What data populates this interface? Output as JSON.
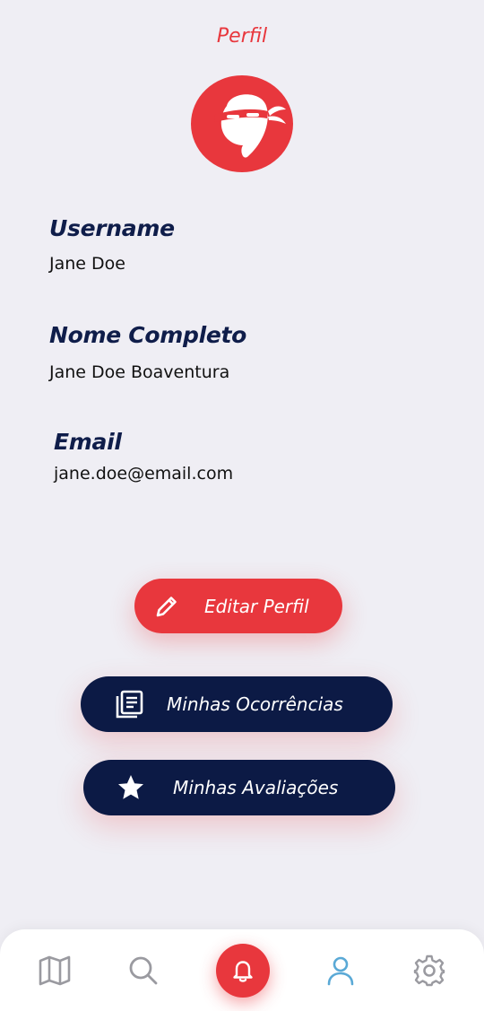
{
  "header": {
    "title": "Perfil"
  },
  "profile": {
    "fields": [
      {
        "label": "Username",
        "value": "Jane Doe"
      },
      {
        "label": "Nome Completo",
        "value": "Jane Doe Boaventura"
      },
      {
        "label": "Email",
        "value": "jane.doe@email.com"
      }
    ]
  },
  "actions": {
    "edit_label": "Editar Perfil",
    "occurrences_label": "Minhas Ocorrências",
    "reviews_label": "Minhas Avaliações"
  },
  "nav": {
    "items": [
      {
        "icon": "map-icon"
      },
      {
        "icon": "search-icon"
      },
      {
        "icon": "bell-icon"
      },
      {
        "icon": "user-icon",
        "active": true
      },
      {
        "icon": "gear-icon"
      }
    ]
  },
  "colors": {
    "accent": "#e8373d",
    "navy": "#0c1a45",
    "active_nav": "#5aa9d6",
    "inactive_nav": "#9a9aa0",
    "background": "#efeef4"
  }
}
